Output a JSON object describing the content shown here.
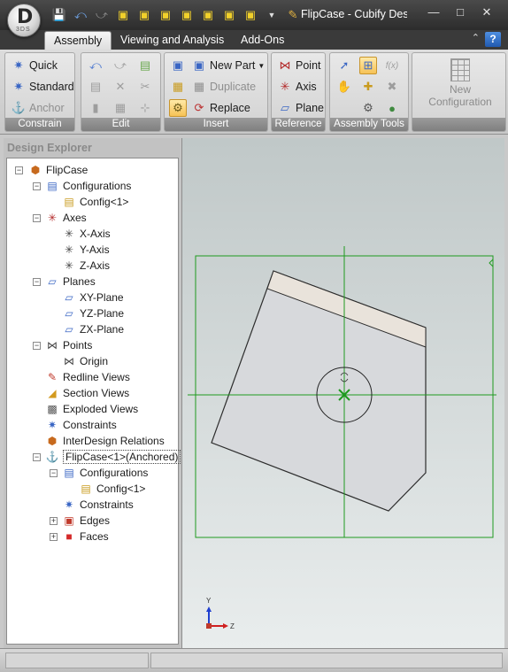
{
  "window": {
    "title": "FlipCase - Cubify Des...",
    "logo_letter": "D",
    "logo_sub": "3DS"
  },
  "tabs": [
    {
      "label": "Assembly",
      "active": true
    },
    {
      "label": "Viewing and Analysis",
      "active": false
    },
    {
      "label": "Add-Ons",
      "active": false
    }
  ],
  "ribbon": {
    "constrain": {
      "label": "Constrain",
      "quick": "Quick",
      "standard": "Standard",
      "anchor": "Anchor"
    },
    "edit": {
      "label": "Edit"
    },
    "insert": {
      "label": "Insert",
      "new_part": "New Part",
      "duplicate": "Duplicate",
      "replace": "Replace"
    },
    "reference": {
      "label": "Reference",
      "point": "Point",
      "axis": "Axis",
      "plane": "Plane"
    },
    "assembly_tools": {
      "label": "Assembly Tools",
      "fx": "f(x)"
    },
    "new_configuration": {
      "line1": "New",
      "line2": "Configuration"
    }
  },
  "explorer": {
    "title": "Design Explorer",
    "nodes": [
      {
        "label": "FlipCase"
      },
      {
        "label": "Configurations"
      },
      {
        "label": "Config<1>"
      },
      {
        "label": "Axes"
      },
      {
        "label": "X-Axis"
      },
      {
        "label": "Y-Axis"
      },
      {
        "label": "Z-Axis"
      },
      {
        "label": "Planes"
      },
      {
        "label": "XY-Plane"
      },
      {
        "label": "YZ-Plane"
      },
      {
        "label": "ZX-Plane"
      },
      {
        "label": "Points"
      },
      {
        "label": "Origin"
      },
      {
        "label": "Redline Views"
      },
      {
        "label": "Section Views"
      },
      {
        "label": "Exploded Views"
      },
      {
        "label": "Constraints"
      },
      {
        "label": "InterDesign Relations"
      },
      {
        "label": "FlipCase<1>(Anchored)"
      },
      {
        "label": "Configurations"
      },
      {
        "label": "Config<1>"
      },
      {
        "label": "Constraints"
      },
      {
        "label": "Edges"
      },
      {
        "label": "Faces"
      }
    ]
  },
  "triad": {
    "y_label": "Y",
    "z_label": "Z"
  },
  "colors": {
    "select_box": "#1f9a1f",
    "part_face": "#d7d9dc",
    "viewport_top": "#c0c8c8"
  }
}
